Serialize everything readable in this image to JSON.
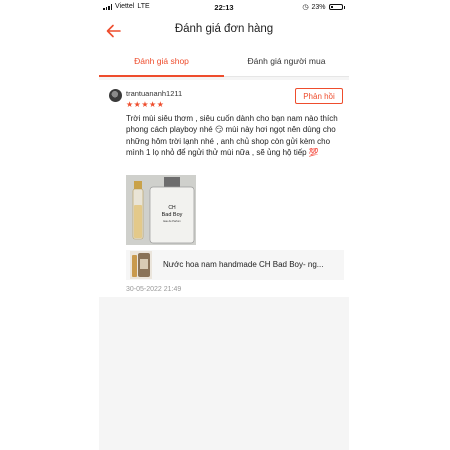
{
  "status_bar": {
    "carrier": "Viettel",
    "network": "LTE",
    "time": "22:13",
    "battery_percent": "23%",
    "battery_level": 0.23
  },
  "header": {
    "title": "Đánh giá đơn hàng",
    "back_icon": "arrow-left-icon"
  },
  "tabs": [
    {
      "label": "Đánh giá shop",
      "active": true
    },
    {
      "label": "Đánh giá người mua",
      "active": false
    }
  ],
  "review": {
    "username": "trantuananh1211",
    "rating": 5,
    "stars": "★★★★★",
    "reply_label": "Phản hồi",
    "text": "Trời mùi siêu thơm , siêu cuốn dành cho bạn nam nào thích phong cách playboy nhé 😏 mùi này hơi ngọt nên dùng cho những hôm trời lạnh nhé , anh chủ shop  còn gửi kèm cho mình 1 lọ nhỏ để ngửi thử mùi nữa , sẽ ủng hộ tiếp 💯",
    "photo_label": {
      "line1": "CH",
      "line2": "Bad Boy",
      "line3": "Eau de Parfum"
    },
    "product_name": "Nước hoa nam handmade CH Bad Boy- ng...",
    "date": "30-05-2022 21:49"
  },
  "colors": {
    "accent": "#ee4d2d",
    "muted": "#999999"
  }
}
